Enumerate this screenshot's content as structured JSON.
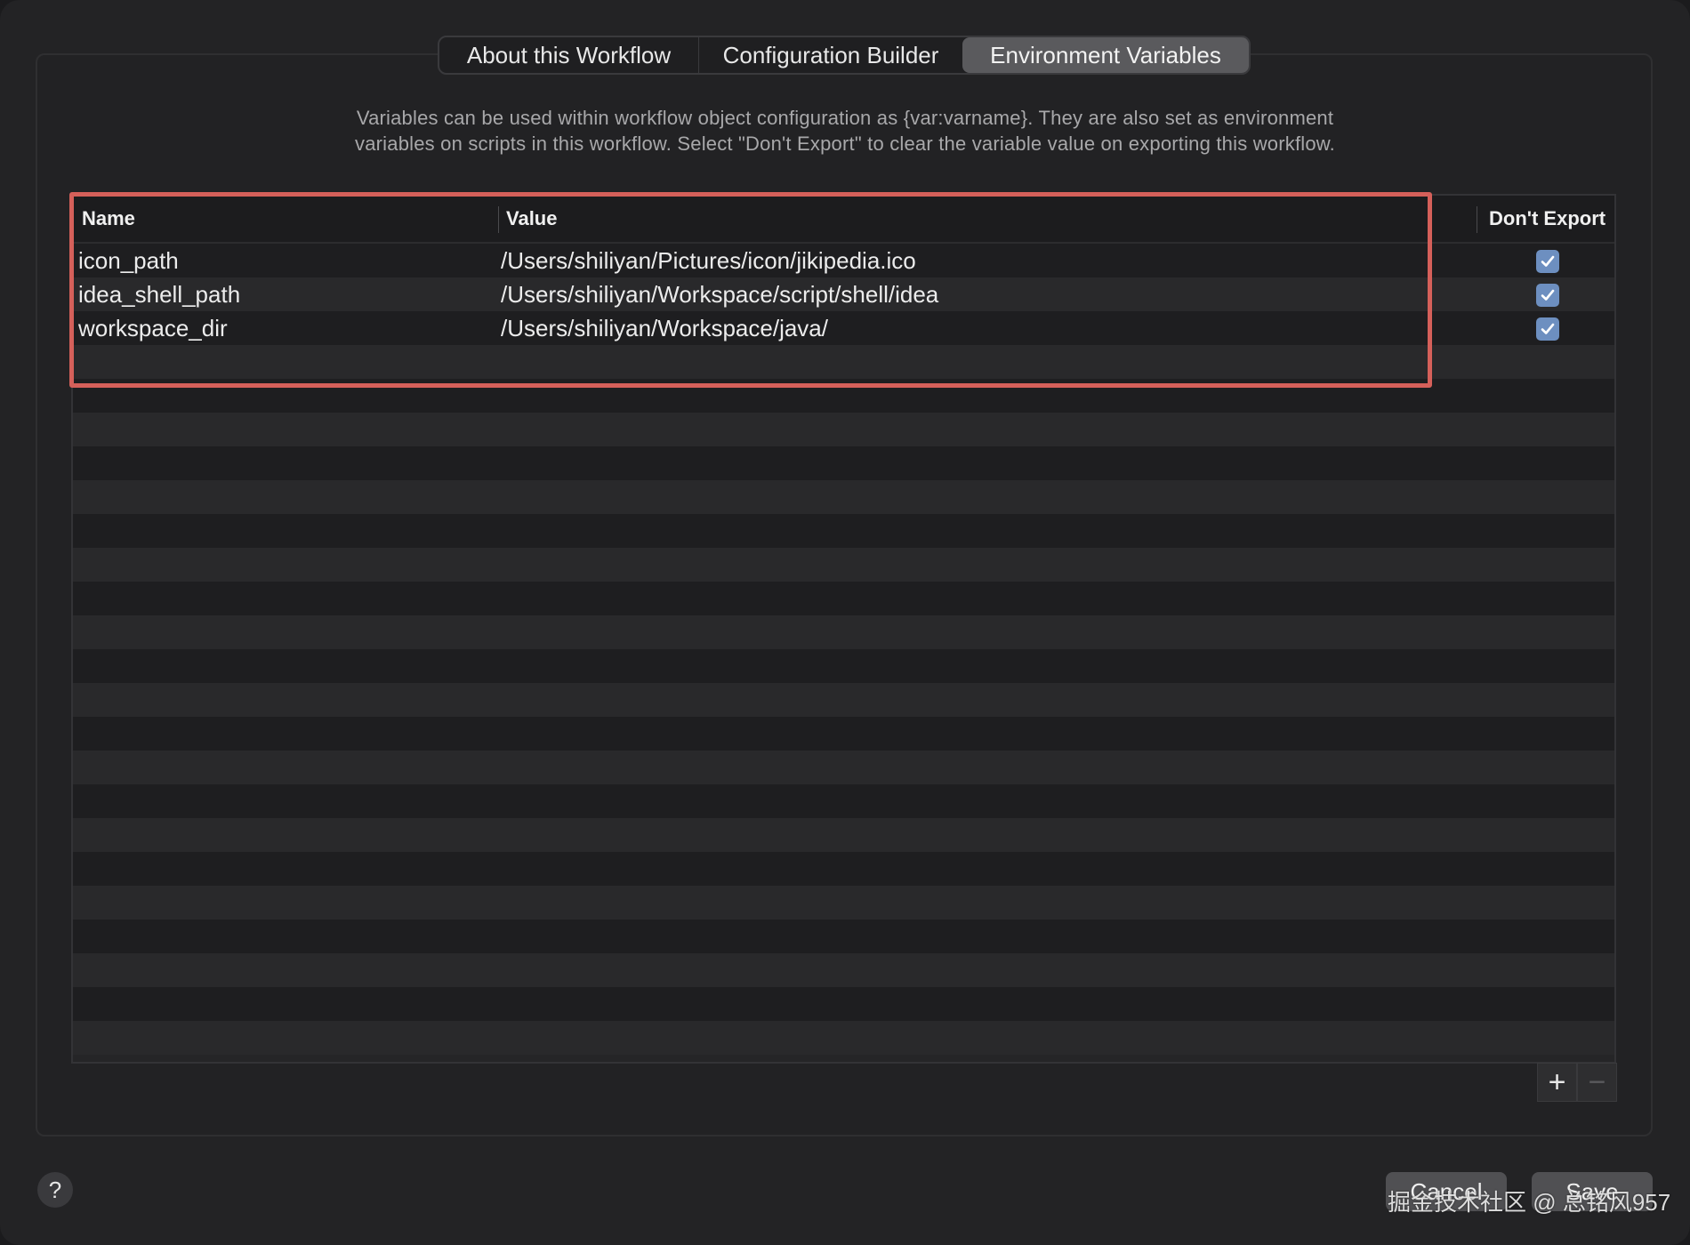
{
  "tabs": [
    {
      "label": "About this Workflow",
      "selected": false
    },
    {
      "label": "Configuration Builder",
      "selected": false
    },
    {
      "label": "Environment Variables",
      "selected": true
    }
  ],
  "description": {
    "line1": "Variables can be used within workflow object configuration as {var:varname}. They are also set as environment",
    "line2": "variables on scripts in this workflow. Select \"Don't Export\" to clear the variable value on exporting this workflow."
  },
  "table": {
    "columns": {
      "name": "Name",
      "value": "Value",
      "dont_export": "Don't Export"
    },
    "rows": [
      {
        "name": "icon_path",
        "value": "/Users/shiliyan/Pictures/icon/jikipedia.ico",
        "dont_export": true
      },
      {
        "name": "idea_shell_path",
        "value": "/Users/shiliyan/Workspace/script/shell/idea",
        "dont_export": true
      },
      {
        "name": "workspace_dir",
        "value": "/Users/shiliyan/Workspace/java/",
        "dont_export": true
      }
    ]
  },
  "controls": {
    "add_icon": "plus-icon",
    "remove_icon": "minus-icon",
    "help_label": "?",
    "help_icon": "question-icon"
  },
  "footer": {
    "cancel_label": "Cancel",
    "save_label": "Save"
  },
  "watermark": "掘金技术社区 @ 总铭风957",
  "colors": {
    "highlight": "#d5605a",
    "checkbox": "#6d8fc0",
    "selected_tab": "#5a5a5d"
  }
}
